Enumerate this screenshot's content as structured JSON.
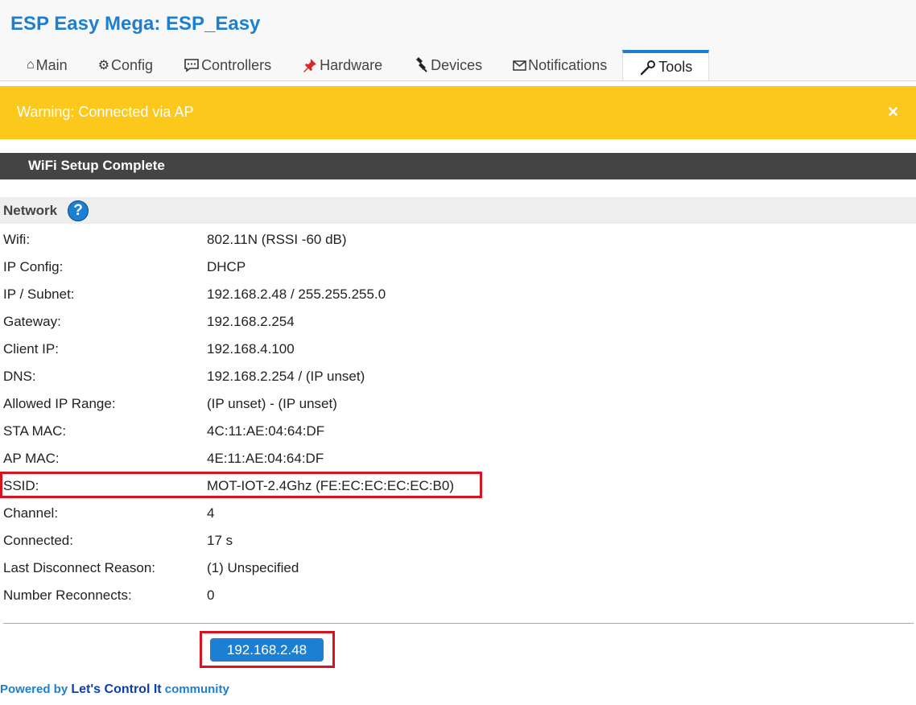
{
  "app": {
    "title": "ESP Easy Mega: ESP_Easy"
  },
  "tabs": [
    {
      "label": "Main",
      "icon": "home-icon"
    },
    {
      "label": "Config",
      "icon": "gear-icon"
    },
    {
      "label": "Controllers",
      "icon": "chat-icon"
    },
    {
      "label": "Hardware",
      "icon": "pin-icon"
    },
    {
      "label": "Devices",
      "icon": "plug-icon"
    },
    {
      "label": "Notifications",
      "icon": "mail-icon"
    },
    {
      "label": "Tools",
      "icon": "wrench-icon",
      "active": true
    }
  ],
  "warning": {
    "text": "Warning: Connected via AP",
    "close": "×"
  },
  "section": {
    "title": "WiFi Setup Complete"
  },
  "network": {
    "heading": "Network",
    "help_symbol": "?",
    "rows": [
      {
        "label": "Wifi:",
        "value": "802.11N (RSSI -60 dB)"
      },
      {
        "label": "IP Config:",
        "value": "DHCP"
      },
      {
        "label": "IP / Subnet:",
        "value": "192.168.2.48 / 255.255.255.0"
      },
      {
        "label": "Gateway:",
        "value": "192.168.2.254"
      },
      {
        "label": "Client IP:",
        "value": "192.168.4.100"
      },
      {
        "label": "DNS:",
        "value": "192.168.2.254 / (IP unset)"
      },
      {
        "label": "Allowed IP Range:",
        "value": "(IP unset) - (IP unset)"
      },
      {
        "label": "STA MAC:",
        "value": "4C:11:AE:04:64:DF"
      },
      {
        "label": "AP MAC:",
        "value": "4E:11:AE:04:64:DF"
      },
      {
        "label": "SSID:",
        "value": "MOT-IOT-2.4Ghz (FE:EC:EC:EC:EC:B0)"
      },
      {
        "label": "Channel:",
        "value": "4"
      },
      {
        "label": "Connected:",
        "value": "17 s"
      },
      {
        "label": "Last Disconnect Reason:",
        "value": "(1) Unspecified"
      },
      {
        "label": "Number Reconnects:",
        "value": "0"
      }
    ]
  },
  "ip_button": {
    "label": "192.168.2.48"
  },
  "footer": {
    "prefix": "Powered by ",
    "link": "Let's Control It",
    "suffix": " community"
  },
  "colors": {
    "accent": "#1c7fd1",
    "warning": "#fdc81c",
    "section_bar": "#444444",
    "highlight": "#d8121f"
  }
}
